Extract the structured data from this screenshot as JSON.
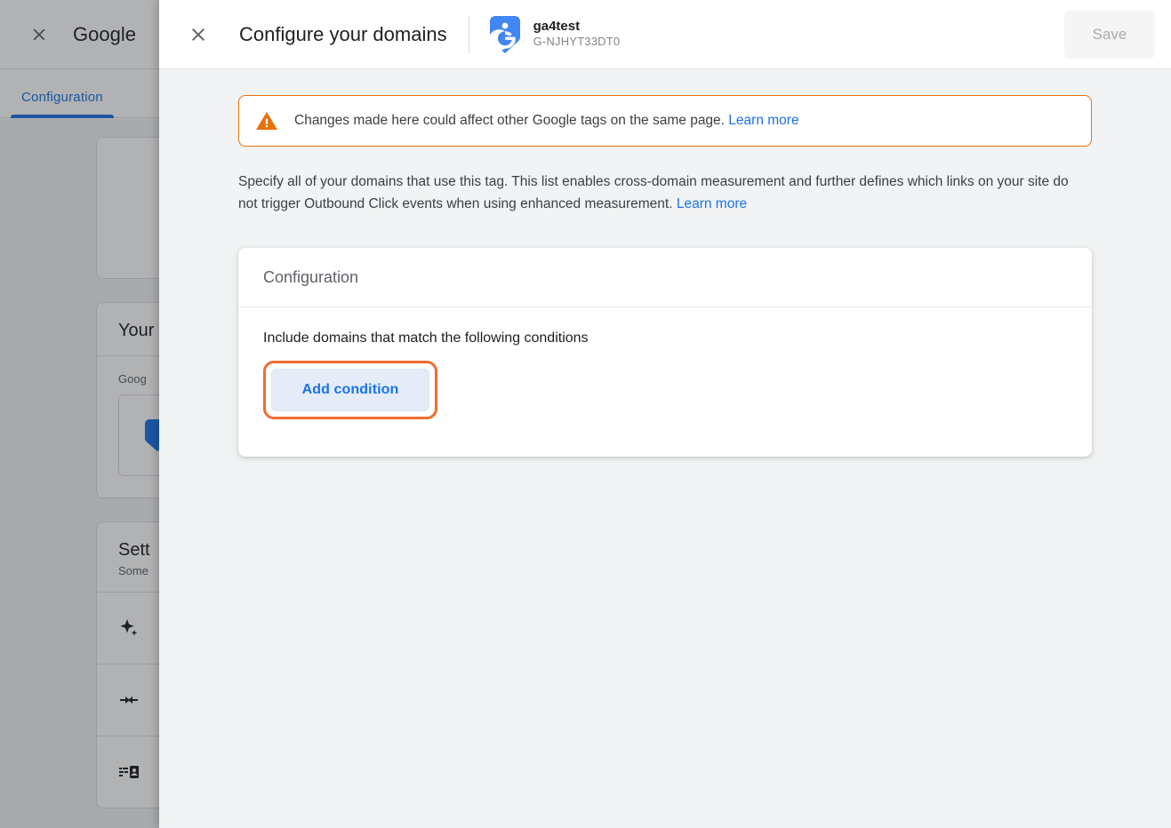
{
  "background": {
    "close_icon": "close-icon",
    "title": "Google",
    "tabs": [
      {
        "label": "Configuration"
      }
    ],
    "cards": [
      {
        "title": "Your",
        "sub": "",
        "label": "Goog"
      },
      {
        "title": "Sett",
        "sub": "Some"
      }
    ],
    "row_icons": [
      "sparkle-icon",
      "arrows-converge-icon",
      "contact-list-icon"
    ]
  },
  "panel": {
    "close_icon": "close-icon",
    "title": "Configure your domains",
    "tag": {
      "icon": "google-tag-icon",
      "name": "ga4test",
      "id": "G-NJHYT33DT0"
    },
    "save_label": "Save",
    "save_disabled": true
  },
  "alert": {
    "icon": "warning-triangle-icon",
    "text": "Changes made here could affect other Google tags on the same page.",
    "link_label": "Learn more",
    "border_color": "#e8710a"
  },
  "description": {
    "text": "Specify all of your domains that use this tag. This list enables cross-domain measurement and further defines which links on your site do not trigger Outbound Click events when using enhanced measurement.",
    "link_label": "Learn more"
  },
  "config_card": {
    "header": "Configuration",
    "conditions_label": "Include domains that match the following conditions",
    "add_condition_label": "Add condition",
    "focus_ring_color": "#f26b34"
  },
  "colors": {
    "accent_blue": "#1a73e8",
    "warning_orange": "#e8710a",
    "panel_bg": "#f1f3f4",
    "card_white": "#ffffff"
  }
}
